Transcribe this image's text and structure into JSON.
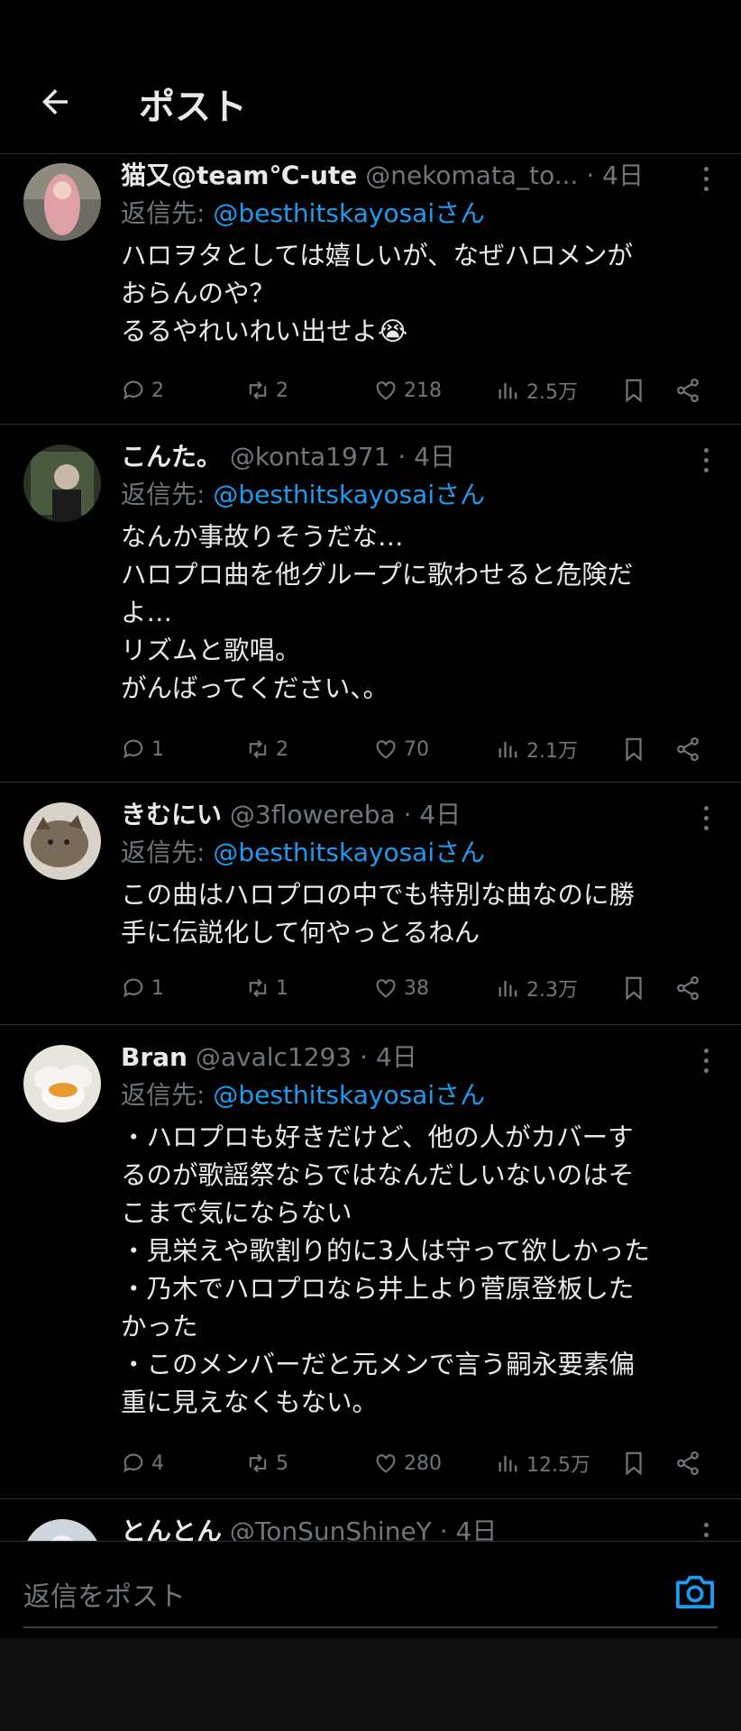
{
  "header": {
    "title": "ポスト"
  },
  "tweets": [
    {
      "name": "猫又@team℃-ute",
      "handle": "@nekomata_to...",
      "time": "4日",
      "reply_prefix": "返信先: ",
      "reply_mention": "@besthitskayosaiさん",
      "body": "ハロヲタとしては嬉しいが、なぜハロメンが\nおらんのや？\nるるやれいれい出せよ😭",
      "replies": "2",
      "reposts": "2",
      "likes": "218",
      "views": "2.5万"
    },
    {
      "name": "こんた。",
      "handle": "@konta1971",
      "time": "4日",
      "reply_prefix": "返信先: ",
      "reply_mention": "@besthitskayosaiさん",
      "body": "なんか事故りそうだな…\nハロプロ曲を他グループに歌わせると危険だ\nよ…\nリズムと歌唱。\nがんばってください、。",
      "replies": "1",
      "reposts": "2",
      "likes": "70",
      "views": "2.1万"
    },
    {
      "name": "きむにい",
      "handle": "@3flowereba",
      "time": "4日",
      "reply_prefix": "返信先: ",
      "reply_mention": "@besthitskayosaiさん",
      "body": "この曲はハロプロの中でも特別な曲なのに勝\n手に伝説化して何やっとるねん",
      "replies": "1",
      "reposts": "1",
      "likes": "38",
      "views": "2.3万"
    },
    {
      "name": "Bran",
      "handle": "@avalc1293",
      "time": "4日",
      "reply_prefix": "返信先: ",
      "reply_mention": "@besthitskayosaiさん",
      "body": "・ハロプロも好きだけど、他の人がカバーす\nるのが歌謡祭ならではなんだしいないのはそ\nこまで気にならない\n・見栄えや歌割り的に3人は守って欲しかった\n・乃木でハロプロなら井上より菅原登板した\nかった\n・このメンバーだと元メンで言う嗣永要素偏\n重に見えなくもない。",
      "replies": "4",
      "reposts": "5",
      "likes": "280",
      "views": "12.5万"
    },
    {
      "name": "とんとん",
      "handle": "@TonSunShineY",
      "time": "4日"
    }
  ],
  "composer": {
    "placeholder": "返信をポスト"
  },
  "colors": {
    "background": "#000000",
    "accent": "#1d9bf0",
    "muted": "#71767b",
    "text": "#e7e9ea"
  },
  "icons": [
    "back-arrow-icon",
    "reply-icon",
    "repost-icon",
    "like-icon",
    "views-icon",
    "bookmark-icon",
    "share-icon",
    "more-icon",
    "camera-icon"
  ]
}
